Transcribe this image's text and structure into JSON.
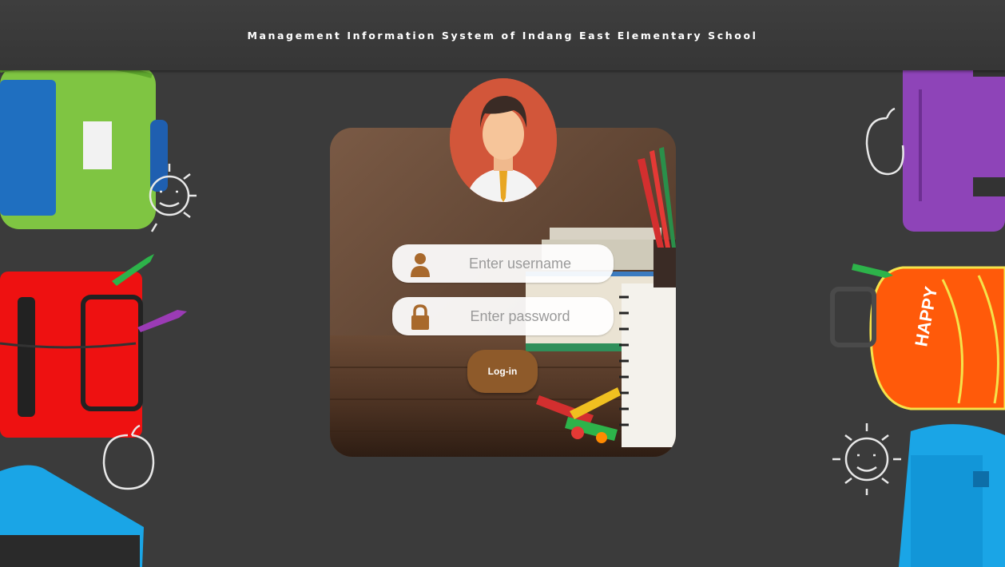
{
  "header": {
    "title": "Management Information System of Indang East Elementary School"
  },
  "login": {
    "username": {
      "placeholder": "Enter username",
      "value": ""
    },
    "password": {
      "placeholder": "Enter password",
      "value": ""
    },
    "button_label": "Log-in"
  },
  "decor": {
    "backpack_text": "HAPPY"
  },
  "colors": {
    "background": "#3b3b3b",
    "avatar_bg": "#d2563a",
    "button": "#8e5a2a",
    "icon": "#a8692c"
  },
  "icons": [
    "user-icon",
    "lock-icon"
  ]
}
